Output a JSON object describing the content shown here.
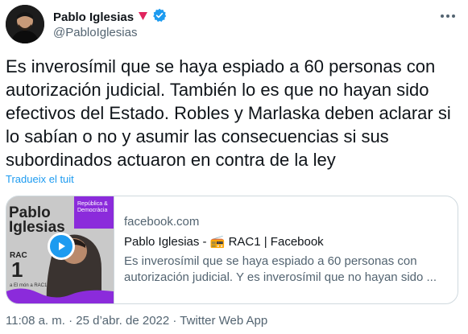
{
  "author": {
    "name": "Pablo Iglesias",
    "handle": "@PabloIglesias"
  },
  "tweet": {
    "text": "Es inverosímil que se haya espiado a 60 personas con autorización judicial. También lo es que no hayan sido efectivos del Estado. Robles y Marlaska deben aclarar si lo sabían o no y asumir las consecuencias si sus subordinados actuaron en contra de la ley",
    "translate_label": "Tradueix el tuit"
  },
  "card": {
    "domain": "facebook.com",
    "title": "Pablo Iglesias - 📻 RAC1 | Facebook",
    "description": "Es inverosímil que se haya espiado a 60 personas con autorización judicial. Y es inverosímil que no hayan sido ...",
    "thumb_title_line1": "Pablo",
    "thumb_title_line2": "Iglesias",
    "thumb_badge": "República & Democràcia",
    "thumb_rac": "RAC",
    "thumb_num": "1",
    "thumb_sub": "a El món a RAC1"
  },
  "meta": {
    "time": "11:08 a. m.",
    "date": "25 d’abr. de 2022",
    "client": "Twitter Web App"
  },
  "colors": {
    "accent": "#1d9bf0",
    "verified": "#1d9bf0",
    "triangle": "#e0245e",
    "badge_purple": "#8b2bdb"
  },
  "icons": [
    "verified-badge-icon",
    "pink-triangle-icon",
    "more-options-icon",
    "play-icon"
  ]
}
